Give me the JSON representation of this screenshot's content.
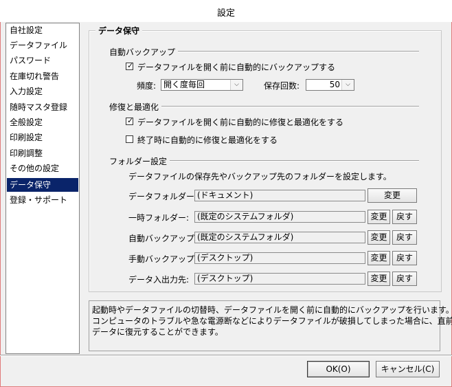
{
  "window": {
    "title": "設定"
  },
  "sidebar": {
    "items": [
      {
        "label": "自社設定",
        "selected": false
      },
      {
        "label": "データファイル",
        "selected": false
      },
      {
        "label": "パスワード",
        "selected": false
      },
      {
        "label": "在庫切れ警告",
        "selected": false
      },
      {
        "label": "入力設定",
        "selected": false
      },
      {
        "label": "随時マスタ登録",
        "selected": false
      },
      {
        "label": "全般設定",
        "selected": false
      },
      {
        "label": "印刷設定",
        "selected": false
      },
      {
        "label": "印刷調整",
        "selected": false
      },
      {
        "label": "その他の設定",
        "selected": false
      },
      {
        "label": "データ保守",
        "selected": true
      },
      {
        "label": "登録・サポート",
        "selected": false
      }
    ]
  },
  "main": {
    "group_title": "データ保守",
    "auto_backup": {
      "section_label": "自動バックアップ",
      "checkbox_label": "データファイルを開く前に自動的にバックアップする",
      "checked": true,
      "frequency_label": "頻度:",
      "frequency_value": "開く度毎回",
      "retain_label": "保存回数:",
      "retain_value": "50"
    },
    "repair": {
      "section_label": "修復と最適化",
      "before_open_label": "データファイルを開く前に自動的に修復と最適化をする",
      "before_open_checked": true,
      "on_exit_label": "終了時に自動的に修復と最適化をする",
      "on_exit_checked": false
    },
    "folders": {
      "section_label": "フォルダー設定",
      "description": "データファイルの保存先やバックアップ先のフォルダーを設定します。",
      "change_label": "変更",
      "reset_label": "戻す",
      "rows": [
        {
          "label": "データフォルダー:",
          "value": "(ドキュメント)",
          "has_reset": false
        },
        {
          "label": "一時フォルダー:",
          "value": "(既定のシステムフォルダ)",
          "has_reset": true
        },
        {
          "label": "自動バックアップ:",
          "value": "(既定のシステムフォルダ)",
          "has_reset": true
        },
        {
          "label": "手動バックアップ:",
          "value": "(デスクトップ)",
          "has_reset": true
        },
        {
          "label": "データ入出力先:",
          "value": "(デスクトップ)",
          "has_reset": true
        }
      ]
    },
    "help_text": [
      "起動時やデータファイルの切替時、データファイルを開く前に自動的にバックアップを行います。",
      "コンピュータのトラブルや急な電源断などによりデータファイルが破損してしまった場合に、直前の",
      "データに復元することができます。"
    ]
  },
  "footer": {
    "ok_label": "OK(O)",
    "cancel_label": "キャンセル(C)"
  },
  "colors": {
    "selection": "#0a246a",
    "frame_border": "#e07a7a"
  }
}
